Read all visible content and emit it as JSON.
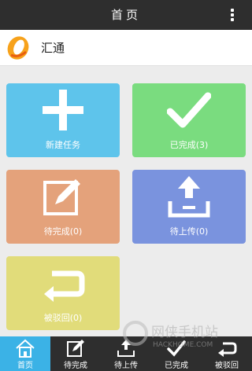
{
  "topbar": {
    "title": "首页",
    "menu_icon": "more-vertical-icon"
  },
  "app": {
    "name": "汇通",
    "logo_icon": "app-logo-icon"
  },
  "tiles": [
    {
      "label": "新建任务",
      "icon": "plus-icon",
      "color": "#5ec4eb"
    },
    {
      "label": "已完成(3)",
      "icon": "checkmark-icon",
      "color": "#7adc7f"
    },
    {
      "label": "待完成(0)",
      "icon": "edit-icon",
      "color": "#e4a27b"
    },
    {
      "label": "待上传(0)",
      "icon": "upload-icon",
      "color": "#7a93de"
    },
    {
      "label": "被驳回(0)",
      "icon": "return-icon",
      "color": "#e1dc7a"
    }
  ],
  "bottom_nav": [
    {
      "label": "首页",
      "icon": "home-icon",
      "active": true
    },
    {
      "label": "待完成",
      "icon": "edit-icon",
      "active": false
    },
    {
      "label": "待上传",
      "icon": "upload-icon",
      "active": false
    },
    {
      "label": "已完成",
      "icon": "checkmark-icon",
      "active": false
    },
    {
      "label": "被驳回",
      "icon": "return-icon",
      "active": false
    }
  ],
  "watermark": {
    "text": "网侠手机站",
    "subtext": "HACKHOME.COM"
  },
  "colors": {
    "topbar": "#2e2e2e",
    "active_nav": "#3bb2e6",
    "background": "#ececec"
  }
}
